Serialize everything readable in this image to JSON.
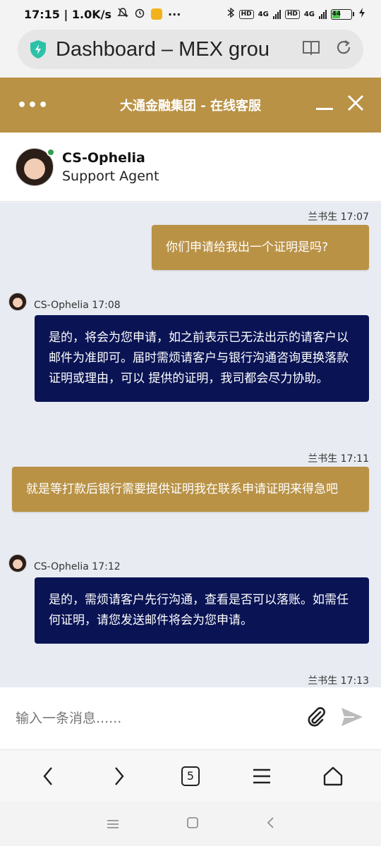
{
  "status_bar": {
    "time_speed": "17:15 | 1.0K/s",
    "battery": "44",
    "net1": "4G",
    "net2": "4G",
    "hd": "HD"
  },
  "browser": {
    "url_title": "Dashboard – MEX grou"
  },
  "chat": {
    "header_title": "大通金融集团 - 在线客服",
    "agent_name": "CS-Ophelia",
    "agent_role": "Support Agent",
    "messages": [
      {
        "side": "user",
        "meta": "兰书生 17:07",
        "text": "你们申请给我出一个证明是吗?"
      },
      {
        "side": "agent",
        "meta": "CS-Ophelia 17:08",
        "text": "是的，将会为您申请，如之前表示已无法出示的请客户以邮件为准即可。届时需烦请客户与银行沟通咨询更换落款证明或理由，可以 提供的证明，我司都会尽力协助。"
      },
      {
        "side": "user",
        "meta": "兰书生 17:11",
        "text": "就是等打款后银行需要提供证明我在联系申请证明来得急吧"
      },
      {
        "side": "agent",
        "meta": "CS-Ophelia 17:12",
        "text": "是的，需烦请客户先行沟通，查看是否可以落账。如需任何证明，请您发送邮件将会为您申请。"
      },
      {
        "side": "user",
        "meta": "兰书生 17:13",
        "text": ""
      }
    ],
    "input_placeholder": "输入一条消息......"
  },
  "browser_nav": {
    "tab_count": "5"
  },
  "colors": {
    "gold": "#b99246",
    "navy": "#0a1454",
    "online": "#2f9e55"
  }
}
